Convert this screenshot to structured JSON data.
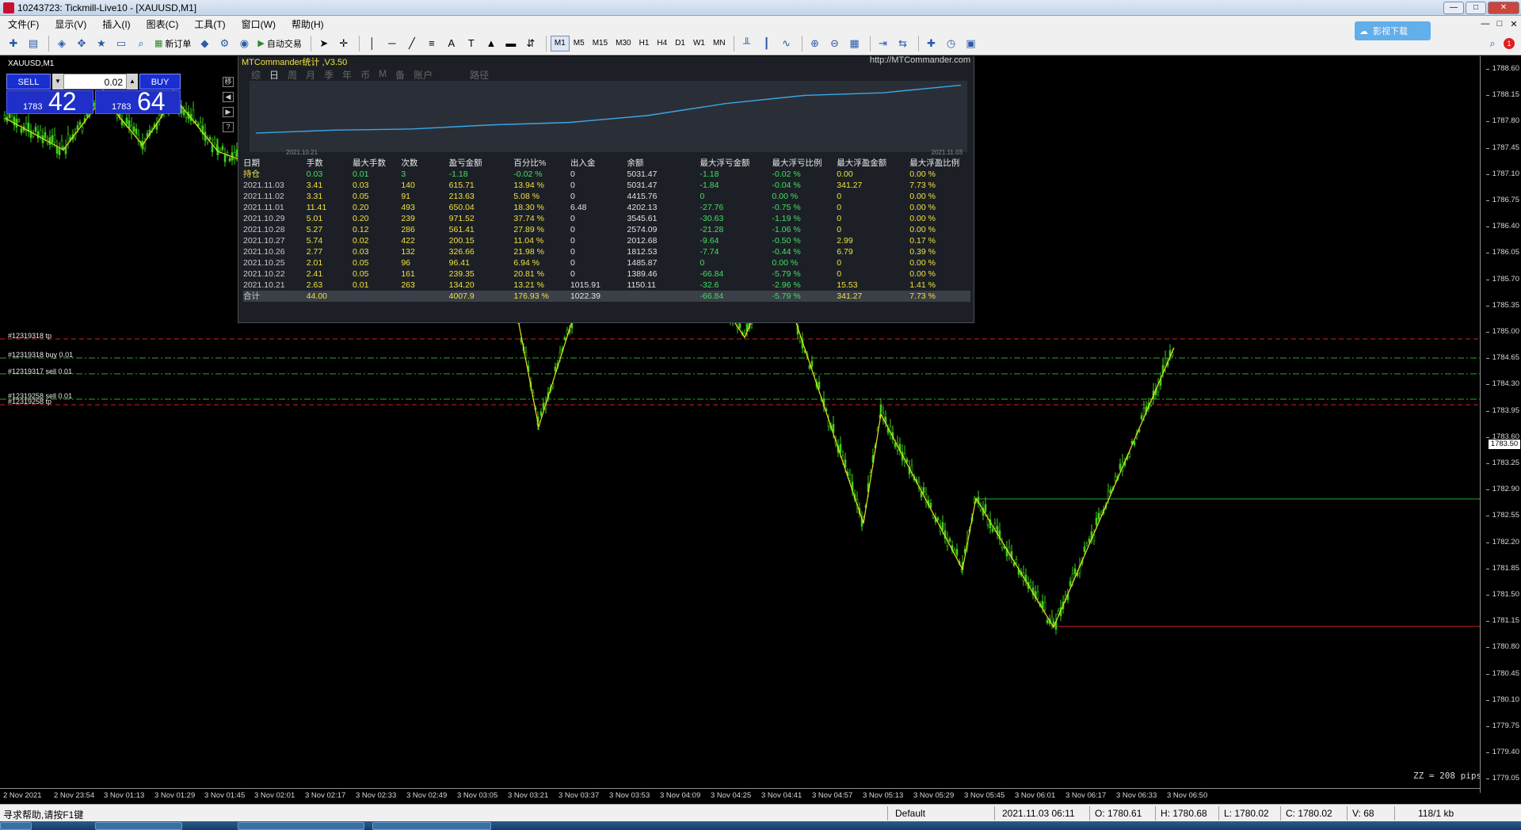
{
  "window": {
    "title": "10243723: Tickmill-Live10 - [XAUUSD,M1]",
    "minimize": "—",
    "maximize": "□",
    "close": "✕"
  },
  "menu": [
    "文件(F)",
    "显示(V)",
    "插入(I)",
    "图表(C)",
    "工具(T)",
    "窗口(W)",
    "帮助(H)"
  ],
  "toolbar": {
    "new_order": "新订单",
    "auto_trade": "自动交易",
    "timeframes": [
      "M1",
      "M5",
      "M15",
      "M30",
      "H1",
      "H4",
      "D1",
      "W1",
      "MN"
    ],
    "active_timeframe": "M1",
    "notification_count": "1"
  },
  "ad_widget_text": "影视下载",
  "chart": {
    "symbol": "XAUUSD,M1",
    "one_click": {
      "sell_label": "SELL",
      "buy_label": "BUY",
      "lot": "0.02",
      "sell_big": "1783",
      "sell_pips": "42",
      "buy_big": "1783",
      "buy_pips": "64"
    },
    "side_icons": [
      "移",
      "◀",
      "▶",
      "?"
    ],
    "price_ticks": [
      "1788.60",
      "1788.15",
      "1787.80",
      "1787.45",
      "1787.10",
      "1786.75",
      "1786.40",
      "1786.05",
      "1785.70",
      "1785.35",
      "1785.00",
      "1784.65",
      "1784.30",
      "1783.95",
      "1783.60",
      "1783.25",
      "1782.90",
      "1782.55",
      "1782.20",
      "1781.85",
      "1781.50",
      "1781.15",
      "1780.80",
      "1780.45",
      "1780.10",
      "1779.75",
      "1779.40",
      "1779.05"
    ],
    "current_price": "1783.50",
    "time_ticks": [
      "2 Nov 2021",
      "2 Nov 23:54",
      "3 Nov 01:13",
      "3 Nov 01:29",
      "3 Nov 01:45",
      "3 Nov 02:01",
      "3 Nov 02:17",
      "3 Nov 02:33",
      "3 Nov 02:49",
      "3 Nov 03:05",
      "3 Nov 03:21",
      "3 Nov 03:37",
      "3 Nov 03:53",
      "3 Nov 04:09",
      "3 Nov 04:25",
      "3 Nov 04:41",
      "3 Nov 04:57",
      "3 Nov 05:13",
      "3 Nov 05:29",
      "3 Nov 05:45",
      "3 Nov 06:01",
      "3 Nov 06:17",
      "3 Nov 06:33",
      "3 Nov 06:50"
    ],
    "order_labels": {
      "tp1": "#12319318 tp",
      "buy1": "#12319318 buy 0.01",
      "sell1": "#12319317 sell 0.01",
      "sell2": "#12319258 sell 0.01",
      "tp2": "#12319258 tp"
    },
    "zz_label": "ZZ = 208 pips",
    "colors": {
      "candle": "#3ecf1a",
      "zigzag": "#e8e020",
      "tp_line": "#d02020",
      "order_line": "#20b020"
    }
  },
  "stats": {
    "header": "MTCommander统计 ,V3.50",
    "url": "http://MTCommander.com",
    "tabs": [
      "综",
      "日",
      "周",
      "月",
      "季",
      "年",
      "币",
      "M",
      "备",
      "账户"
    ],
    "active_tab": "日",
    "path_label": "路径",
    "equity_start": "2021.10.21",
    "equity_end": "2021.11.03",
    "columns": [
      "日期",
      "手数",
      "最大手数",
      "次数",
      "盈亏金额",
      "百分比%",
      "出入金",
      "余额",
      "最大浮亏金额",
      "最大浮亏比例",
      "最大浮盈金额",
      "最大浮盈比例"
    ],
    "rows": [
      [
        "持仓",
        "0.03",
        "0.01",
        "3",
        "-1.18",
        "-0.02 %",
        "0",
        "5031.47",
        "-1.18",
        "-0.02 %",
        "0.00",
        "0.00 %"
      ],
      [
        "2021.11.03",
        "3.41",
        "0.03",
        "140",
        "615.71",
        "13.94 %",
        "0",
        "5031.47",
        "-1.84",
        "-0.04 %",
        "341.27",
        "7.73 %"
      ],
      [
        "2021.11.02",
        "3.31",
        "0.05",
        "91",
        "213.63",
        "5.08 %",
        "0",
        "4415.76",
        "0",
        "0.00 %",
        "0",
        "0.00 %"
      ],
      [
        "2021.11.01",
        "11.41",
        "0.20",
        "493",
        "650.04",
        "18.30 %",
        "6.48",
        "4202.13",
        "-27.76",
        "-0.75 %",
        "0",
        "0.00 %"
      ],
      [
        "2021.10.29",
        "5.01",
        "0.20",
        "239",
        "971.52",
        "37.74 %",
        "0",
        "3545.61",
        "-30.63",
        "-1.19 %",
        "0",
        "0.00 %"
      ],
      [
        "2021.10.28",
        "5.27",
        "0.12",
        "286",
        "561.41",
        "27.89 %",
        "0",
        "2574.09",
        "-21.28",
        "-1.06 %",
        "0",
        "0.00 %"
      ],
      [
        "2021.10.27",
        "5.74",
        "0.02",
        "422",
        "200.15",
        "11.04 %",
        "0",
        "2012.68",
        "-9.64",
        "-0.50 %",
        "2.99",
        "0.17 %"
      ],
      [
        "2021.10.26",
        "2.77",
        "0.03",
        "132",
        "326.66",
        "21.98 %",
        "0",
        "1812.53",
        "-7.74",
        "-0.44 %",
        "6.79",
        "0.39 %"
      ],
      [
        "2021.10.25",
        "2.01",
        "0.05",
        "96",
        "96.41",
        "6.94 %",
        "0",
        "1485.87",
        "0",
        "0.00 %",
        "0",
        "0.00 %"
      ],
      [
        "2021.10.22",
        "2.41",
        "0.05",
        "161",
        "239.35",
        "20.81 %",
        "0",
        "1389.46",
        "-66.84",
        "-5.79 %",
        "0",
        "0.00 %"
      ],
      [
        "2021.10.21",
        "2.63",
        "0.01",
        "263",
        "134.20",
        "13.21 %",
        "1015.91",
        "1150.11",
        "-32.6",
        "-2.96 %",
        "15.53",
        "1.41 %"
      ],
      [
        "合计",
        "44.00",
        "",
        "",
        "4007.9",
        "176.93 %",
        "1022.39",
        "",
        "-66.84",
        "-5.79 %",
        "341.27",
        "7.73 %"
      ]
    ]
  },
  "status": {
    "help": "寻求帮助,请按F1键",
    "profile": "Default",
    "datetime": "2021.11.03 06:11",
    "open": "O: 1780.61",
    "high": "H: 1780.68",
    "low": "L: 1780.02",
    "close": "C: 1780.02",
    "volume": "V: 68",
    "traffic": "118/1 kb"
  }
}
